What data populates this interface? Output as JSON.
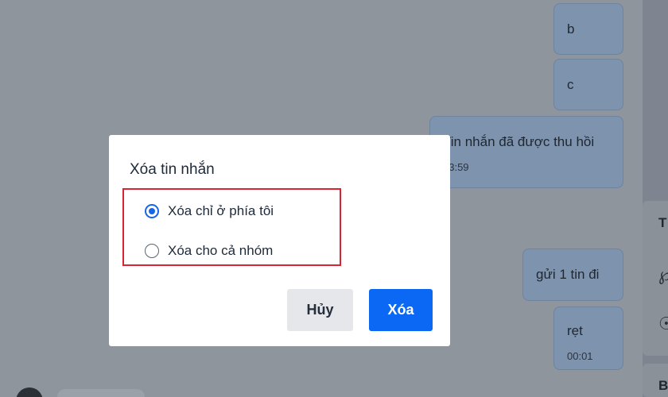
{
  "chat": {
    "messages": [
      {
        "text": "b"
      },
      {
        "text": "c"
      },
      {
        "text": "Tin nhắn đã được thu hồi",
        "time": "23:59"
      },
      {
        "text": "gửi 1 tin đi"
      },
      {
        "text": "rẹt",
        "time": "00:01"
      }
    ]
  },
  "side_panel": {
    "card1_letter": "T",
    "card2_letter": "B"
  },
  "dialog": {
    "title": "Xóa tin nhắn",
    "options": [
      {
        "label": "Xóa chỉ ở phía tôi",
        "selected": true
      },
      {
        "label": "Xóa cho cả nhóm",
        "selected": false
      }
    ],
    "cancel_label": "Hủy",
    "delete_label": "Xóa"
  },
  "colors": {
    "primary": "#0a68f5",
    "highlight": "#d82433",
    "overlay": "#8f959d"
  }
}
